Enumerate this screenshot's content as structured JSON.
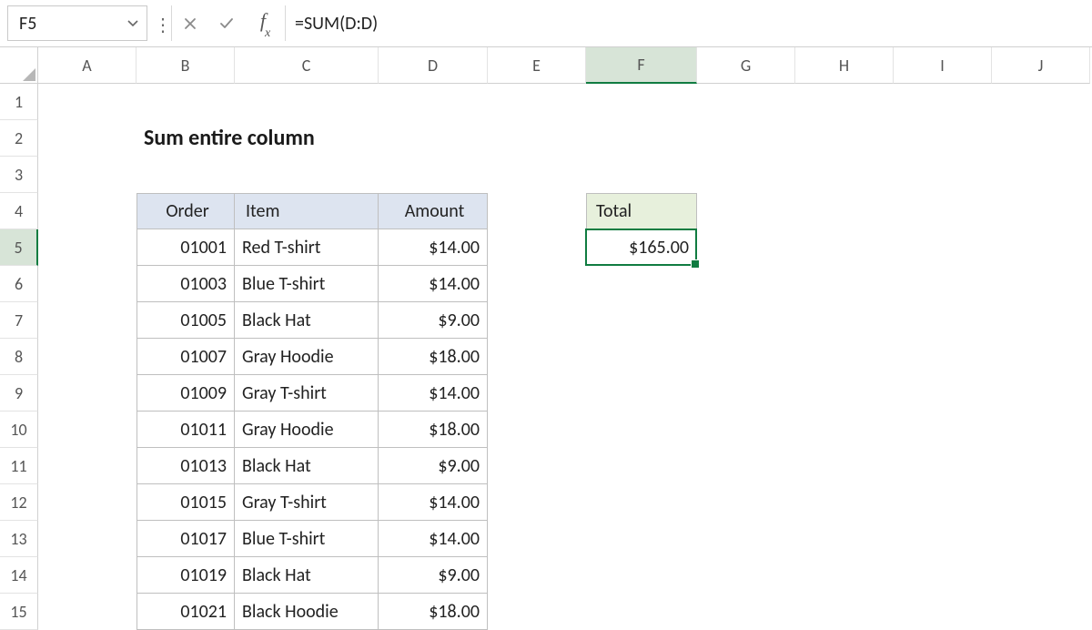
{
  "name_box": "F5",
  "formula": "=SUM(D:D)",
  "columns": [
    "A",
    "B",
    "C",
    "D",
    "E",
    "F",
    "G",
    "H",
    "I",
    "J"
  ],
  "visible_rows": 15,
  "selected_cell": {
    "col": "F",
    "row": 5
  },
  "title": "Sum entire column",
  "table": {
    "headers": {
      "order": "Order",
      "item": "Item",
      "amount": "Amount"
    },
    "rows": [
      {
        "order": "01001",
        "item": "Red T-shirt",
        "amount": "$14.00"
      },
      {
        "order": "01003",
        "item": "Blue T-shirt",
        "amount": "$14.00"
      },
      {
        "order": "01005",
        "item": "Black Hat",
        "amount": "$9.00"
      },
      {
        "order": "01007",
        "item": "Gray Hoodie",
        "amount": "$18.00"
      },
      {
        "order": "01009",
        "item": "Gray T-shirt",
        "amount": "$14.00"
      },
      {
        "order": "01011",
        "item": "Gray Hoodie",
        "amount": "$18.00"
      },
      {
        "order": "01013",
        "item": "Black Hat",
        "amount": "$9.00"
      },
      {
        "order": "01015",
        "item": "Gray T-shirt",
        "amount": "$14.00"
      },
      {
        "order": "01017",
        "item": "Blue T-shirt",
        "amount": "$14.00"
      },
      {
        "order": "01019",
        "item": "Black Hat",
        "amount": "$9.00"
      },
      {
        "order": "01021",
        "item": "Black Hoodie",
        "amount": "$18.00"
      }
    ]
  },
  "total": {
    "label": "Total",
    "value": "$165.00"
  }
}
